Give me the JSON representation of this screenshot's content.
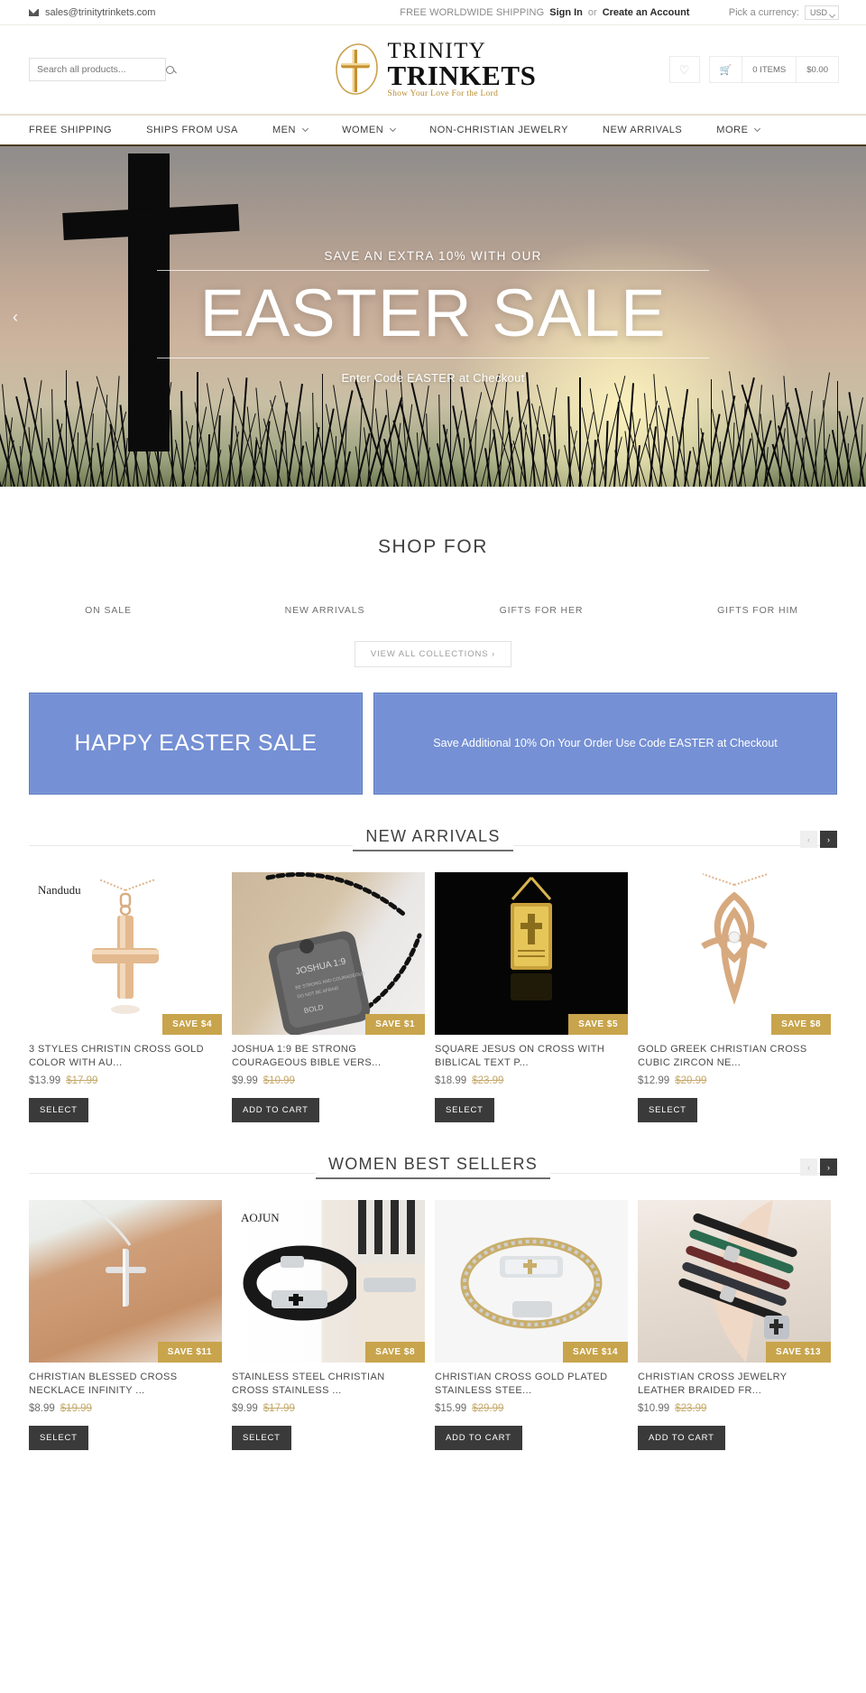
{
  "topbar": {
    "email": "sales@trinitytrinkets.com",
    "mail_icon": "envelope-icon",
    "shipping_note": "FREE WORLDWIDE SHIPPING",
    "sign_in": "Sign In",
    "or": "or",
    "create_account": "Create an Account",
    "currency_label": "Pick a currency:",
    "currency_value": "USD",
    "currency_options": [
      "USD"
    ]
  },
  "header": {
    "search_placeholder": "Search all products...",
    "search_value": "",
    "search_icon": "search-icon",
    "logo": {
      "line1": "TRINITY",
      "line2": "TRINKETS",
      "tagline": "Show Your Love For the Lord",
      "mark": "cross-in-circle-icon"
    },
    "wishlist_icon": "heart-icon",
    "cart_icon": "shopping-cart-icon",
    "cart_items": "0 ITEMS",
    "cart_total": "$0.00"
  },
  "nav": {
    "items": [
      {
        "label": "FREE SHIPPING",
        "caret": false
      },
      {
        "label": "SHIPS FROM USA",
        "caret": false
      },
      {
        "label": "MEN",
        "caret": true
      },
      {
        "label": "WOMEN",
        "caret": true
      },
      {
        "label": "NON-CHRISTIAN JEWELRY",
        "caret": false
      },
      {
        "label": "NEW ARRIVALS",
        "caret": false
      },
      {
        "label": "MORE",
        "caret": true
      }
    ]
  },
  "hero": {
    "kicker": "SAVE AN EXTRA 10% WITH OUR",
    "title": "EASTER SALE",
    "subtitle": "Enter Code EASTER at Checkout",
    "prev_arrow": "chevron-left-icon"
  },
  "shop_for": {
    "heading": "SHOP FOR",
    "collections": [
      "ON SALE",
      "NEW ARRIVALS",
      "GIFTS FOR HER",
      "GIFTS FOR HIM"
    ],
    "view_all": "VIEW ALL COLLECTIONS ›"
  },
  "promos": {
    "accent": "#7590d4",
    "left": "HAPPY EASTER SALE",
    "right": "Save Additional 10% On Your Order Use Code EASTER at Checkout"
  },
  "sections": [
    {
      "title": "NEW ARRIVALS",
      "prev": "‹",
      "next": "›",
      "products": [
        {
          "title": "3 STYLES CHRISTIN CROSS GOLD COLOR WITH AU...",
          "price": "$13.99",
          "compare_at": "$17.99",
          "badge": "SAVE $4",
          "cta": "SELECT",
          "brand_watermark": "Nandudu"
        },
        {
          "title": "JOSHUA 1:9 BE STRONG COURAGEOUS BIBLE VERS...",
          "price": "$9.99",
          "compare_at": "$10.99",
          "badge": "SAVE $1",
          "cta": "ADD TO CART",
          "brand_watermark": ""
        },
        {
          "title": "SQUARE JESUS ON CROSS WITH BIBLICAL TEXT P...",
          "price": "$18.99",
          "compare_at": "$23.99",
          "badge": "SAVE $5",
          "cta": "SELECT",
          "brand_watermark": ""
        },
        {
          "title": "GOLD GREEK CHRISTIAN CROSS CUBIC ZIRCON NE...",
          "price": "$12.99",
          "compare_at": "$20.99",
          "badge": "SAVE $8",
          "cta": "SELECT",
          "brand_watermark": ""
        }
      ]
    },
    {
      "title": "WOMEN BEST SELLERS",
      "prev": "‹",
      "next": "›",
      "products": [
        {
          "title": "CHRISTIAN BLESSED CROSS NECKLACE INFINITY ...",
          "price": "$8.99",
          "compare_at": "$19.99",
          "badge": "SAVE $11",
          "cta": "SELECT",
          "brand_watermark": ""
        },
        {
          "title": "STAINLESS STEEL CHRISTIAN CROSS STAINLESS ...",
          "price": "$9.99",
          "compare_at": "$17.99",
          "badge": "SAVE $8",
          "cta": "SELECT",
          "brand_watermark": "AOJUN"
        },
        {
          "title": "CHRISTIAN CROSS GOLD PLATED STAINLESS STEE...",
          "price": "$15.99",
          "compare_at": "$29.99",
          "badge": "SAVE $14",
          "cta": "ADD TO CART",
          "brand_watermark": ""
        },
        {
          "title": "CHRISTIAN CROSS JEWELRY LEATHER BRAIDED FR...",
          "price": "$10.99",
          "compare_at": "$23.99",
          "badge": "SAVE $13",
          "cta": "ADD TO CART",
          "brand_watermark": ""
        }
      ]
    }
  ]
}
